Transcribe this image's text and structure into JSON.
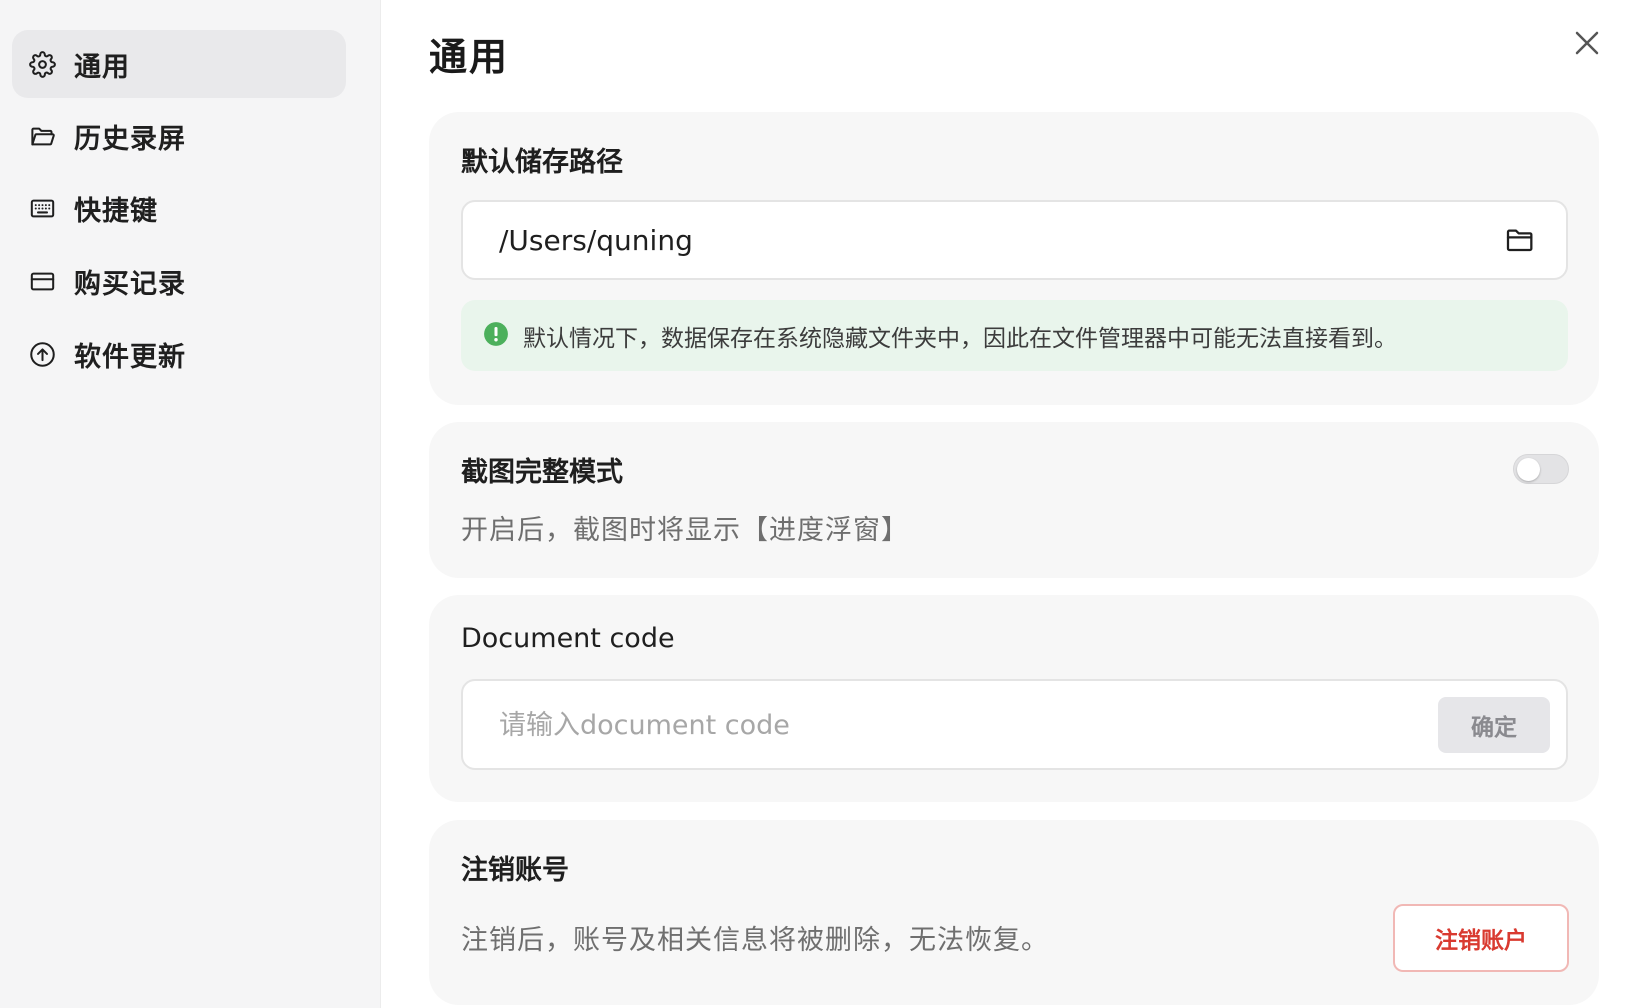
{
  "sidebar": {
    "items": [
      {
        "label": "通用",
        "icon": "gear-icon",
        "active": true
      },
      {
        "label": "历史录屏",
        "icon": "folder-icon",
        "active": false
      },
      {
        "label": "快捷键",
        "icon": "keyboard-icon",
        "active": false
      },
      {
        "label": "购买记录",
        "icon": "card-icon",
        "active": false
      },
      {
        "label": "软件更新",
        "icon": "upload-circle-icon",
        "active": false
      }
    ]
  },
  "header": {
    "title": "通用",
    "close_icon": "close-icon"
  },
  "storage": {
    "title": "默认储存路径",
    "path": "/Users/quning",
    "folder_icon": "folder-icon",
    "info_icon": "exclamation-circle-icon",
    "info_text": "默认情况下，数据保存在系统隐藏文件夹中，因此在文件管理器中可能无法直接看到。",
    "info_color": "#4cb05c"
  },
  "screenshot_mode": {
    "title": "截图完整模式",
    "description": "开启后，截图时将显示【进度浮窗】",
    "enabled": false
  },
  "document_code": {
    "title": "Document code",
    "placeholder": "请输入document code",
    "confirm_label": "确定"
  },
  "account": {
    "title": "注销账号",
    "description": "注销后，账号及相关信息将被删除，无法恢复。",
    "delete_label": "注销账户",
    "danger_color": "#d93a30"
  }
}
